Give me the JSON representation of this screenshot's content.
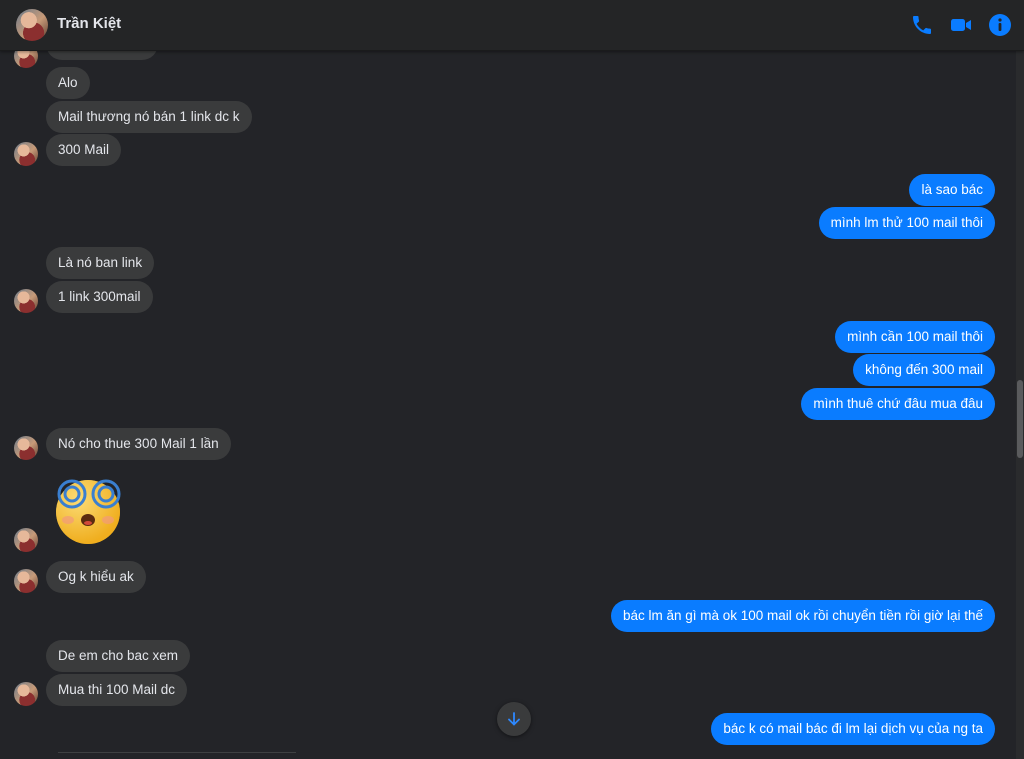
{
  "contact": {
    "name": "Trần Kiệt"
  },
  "header_icons": [
    "phone-icon",
    "video-camera-icon",
    "info-icon"
  ],
  "colors": {
    "accent": "#0a7cff",
    "incoming_bubble": "#3a3b3c",
    "background": "#232428"
  },
  "messages": {
    "in": [
      "Alo",
      "Mail thương nó bán 1 link dc k",
      "300 Mail",
      "Là nó ban link",
      "1 link 300mail",
      "Nó cho thue 300 Mail 1 lần",
      "Og k hiểu ak",
      "De em cho bac xem",
      "Mua thi 100 Mail dc"
    ],
    "out": [
      "là sao bác",
      "mình lm thử 100 mail thôi",
      "mình cần 100 mail thôi",
      "không đến 300 mail",
      "mình thuê chứ đâu mua đâu",
      "bác lm ăn gì mà ok 100 mail ok rồi chuyển tiền rồi giờ lại thế",
      "bác k có mail bác đi lm lại dịch vụ của ng ta"
    ],
    "sticker": "dizzy-face-sticker"
  }
}
